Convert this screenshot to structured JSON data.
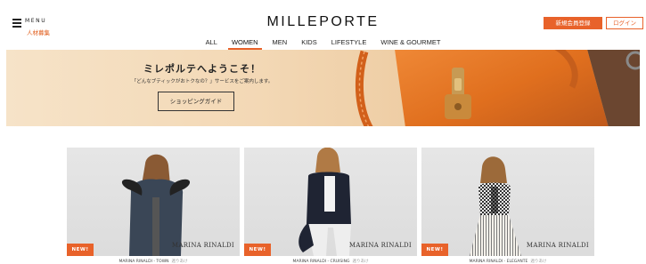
{
  "header": {
    "menu_label": "MENU",
    "recruit_label": "人材募集",
    "logo": "MILLEPORTE",
    "register_label": "新規会員登録",
    "login_label": "ログイン"
  },
  "nav": {
    "items": [
      "ALL",
      "WOMEN",
      "MEN",
      "KIDS",
      "LIFESTYLE",
      "WINE & GOURMET"
    ],
    "active": "WOMEN"
  },
  "banner": {
    "title": "ミレポルテへようこそ！",
    "subtitle": "「どんなブティックがおトクなの？」サービスをご案内します。",
    "button_label": "ショッピングガイド"
  },
  "products": [
    {
      "badge": "NEW!",
      "brand": "MARINA RINALDI",
      "caption": "MARINA RINALDI - TOWN",
      "sub": "週りあけ",
      "coat_color": "#3a4656"
    },
    {
      "badge": "NEW!",
      "brand": "MARINA RINALDI",
      "caption": "MARINA RINALDI - CRUISING",
      "sub": "週りあけ",
      "coat_color": "#1f2433"
    },
    {
      "badge": "NEW!",
      "brand": "MARINA RINALDI",
      "caption": "MARINA RINALDI - ELEGANTE",
      "sub": "週りあけ",
      "coat_color": "#3b3b3b"
    }
  ],
  "colors": {
    "accent": "#e8622a",
    "bag": "#e07a2a"
  }
}
